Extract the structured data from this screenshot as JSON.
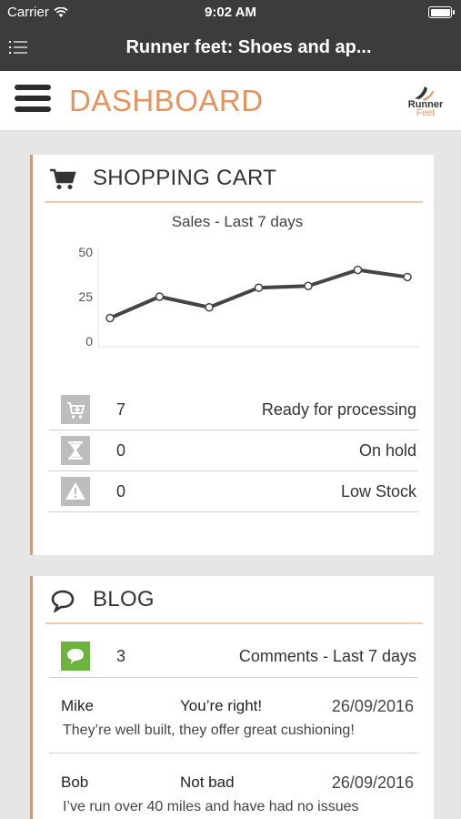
{
  "status_bar": {
    "carrier": "Carrier",
    "time": "9:02 AM"
  },
  "nav": {
    "title": "Runner feet: Shoes and ap..."
  },
  "header": {
    "title": "DASHBOARD",
    "logo_line1": "Runner",
    "logo_line2": "Feet"
  },
  "cart": {
    "title": "SHOPPING CART",
    "stats": [
      {
        "icon": "cart-plus-icon",
        "count": "7",
        "label": "Ready for processing"
      },
      {
        "icon": "hourglass-icon",
        "count": "0",
        "label": "On hold"
      },
      {
        "icon": "warning-icon",
        "count": "0",
        "label": "Low Stock"
      }
    ]
  },
  "chart_data": {
    "type": "line",
    "title": "Sales - Last 7 days",
    "xlabel": "",
    "ylabel": "",
    "ylim": [
      0,
      50
    ],
    "yticks": [
      "50",
      "25",
      "0"
    ],
    "x": [
      1,
      2,
      3,
      4,
      5,
      6,
      7
    ],
    "series": [
      {
        "values": [
          13,
          25,
          19,
          30,
          31,
          40,
          36
        ]
      }
    ],
    "grid": false,
    "colors": {
      "line": "#444444"
    }
  },
  "blog": {
    "title": "BLOG",
    "summary": {
      "icon": "comment-badge-icon",
      "count": "3",
      "label": "Comments - Last 7 days"
    },
    "comments": [
      {
        "author": "Mike",
        "subject": "You’re right!",
        "date": "26/09/2016",
        "excerpt": "They’re well built, they offer great cushioning!"
      },
      {
        "author": "Bob",
        "subject": "Not bad",
        "date": "26/09/2016",
        "excerpt": "I’ve run over 40 miles and have had no issues"
      }
    ]
  },
  "colors": {
    "accent": "#e8935c",
    "bar": "#3c3c3c",
    "stat_icon": "#bdbdbd",
    "comment_icon": "#6cb33f"
  }
}
